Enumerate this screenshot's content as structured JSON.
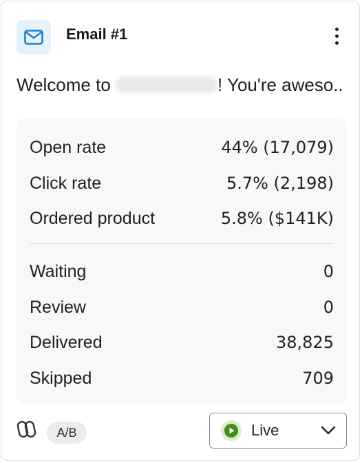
{
  "card": {
    "title": "Email #1",
    "subject_prefix": "Welcome to ",
    "subject_suffix": "! You're aweso..."
  },
  "metrics": [
    {
      "label": "Open rate",
      "value": "44% (17,079)"
    },
    {
      "label": "Click rate",
      "value": "5.7% (2,198)"
    },
    {
      "label": "Ordered product",
      "value": "5.8% ($141K)"
    }
  ],
  "counts": [
    {
      "label": "Waiting",
      "value": "0"
    },
    {
      "label": "Review",
      "value": "0"
    },
    {
      "label": "Delivered",
      "value": "38,825"
    },
    {
      "label": "Skipped",
      "value": "709"
    }
  ],
  "footer": {
    "ab_label": "A/B",
    "status_label": "Live"
  },
  "icons": {
    "mail": "mail-icon",
    "menu": "more-vertical-icon",
    "link": "link-icon",
    "play": "play-icon",
    "dropdown": "chevron-down-icon"
  },
  "colors": {
    "mail_icon": "#1a7fd0",
    "mail_tile": "#e6f2fb",
    "live_green": "#4a8a1c",
    "live_bg": "#d8efc8",
    "stats_bg": "#f7f8fa"
  }
}
